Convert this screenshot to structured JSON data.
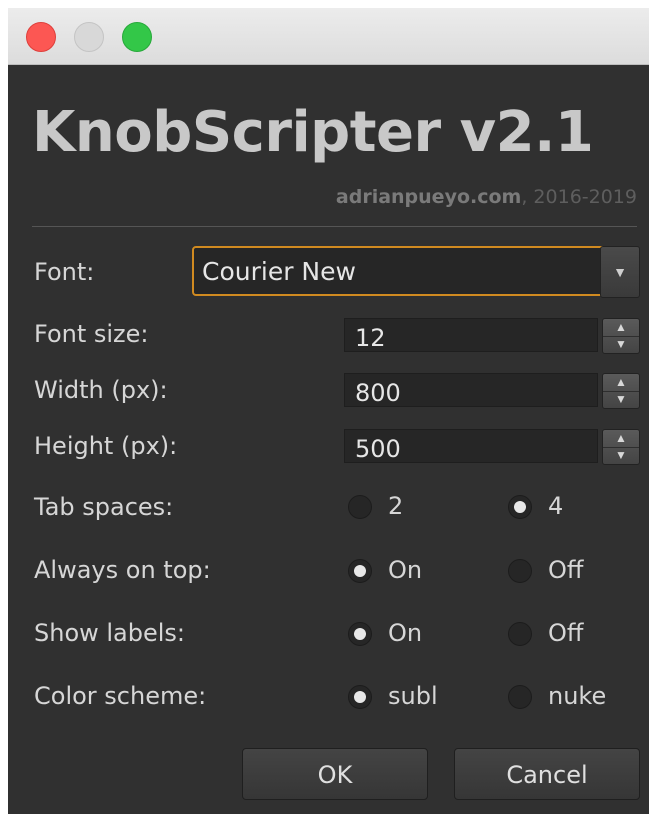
{
  "window": {
    "traffic_lights": {
      "close": "#fc5753",
      "minimize": "#d8d8d8",
      "maximize": "#33c748"
    }
  },
  "header": {
    "title": "KnobScripter v2.1",
    "site": "adrianpueyo.com",
    "years": ", 2016-2019"
  },
  "form": {
    "font": {
      "label": "Font:",
      "value": "Courier New",
      "arrow_icon": "chevron-down-icon"
    },
    "font_size": {
      "label": "Font size:",
      "value": "12"
    },
    "width": {
      "label": "Width (px):",
      "value": "800"
    },
    "height": {
      "label": "Height (px):",
      "value": "500"
    },
    "tab_spaces": {
      "label": "Tab spaces:",
      "options": [
        {
          "label": "2",
          "checked": false
        },
        {
          "label": "4",
          "checked": true
        }
      ]
    },
    "always_on_top": {
      "label": "Always on top:",
      "options": [
        {
          "label": "On",
          "checked": true
        },
        {
          "label": "Off",
          "checked": false
        }
      ]
    },
    "show_labels": {
      "label": "Show labels:",
      "options": [
        {
          "label": "On",
          "checked": true
        },
        {
          "label": "Off",
          "checked": false
        }
      ]
    },
    "color_scheme": {
      "label": "Color scheme:",
      "options": [
        {
          "label": "subl",
          "checked": true
        },
        {
          "label": "nuke",
          "checked": false
        }
      ]
    }
  },
  "buttons": {
    "ok": "OK",
    "cancel": "Cancel"
  },
  "colors": {
    "accent_focus": "#d08a20",
    "background": "#303030"
  }
}
